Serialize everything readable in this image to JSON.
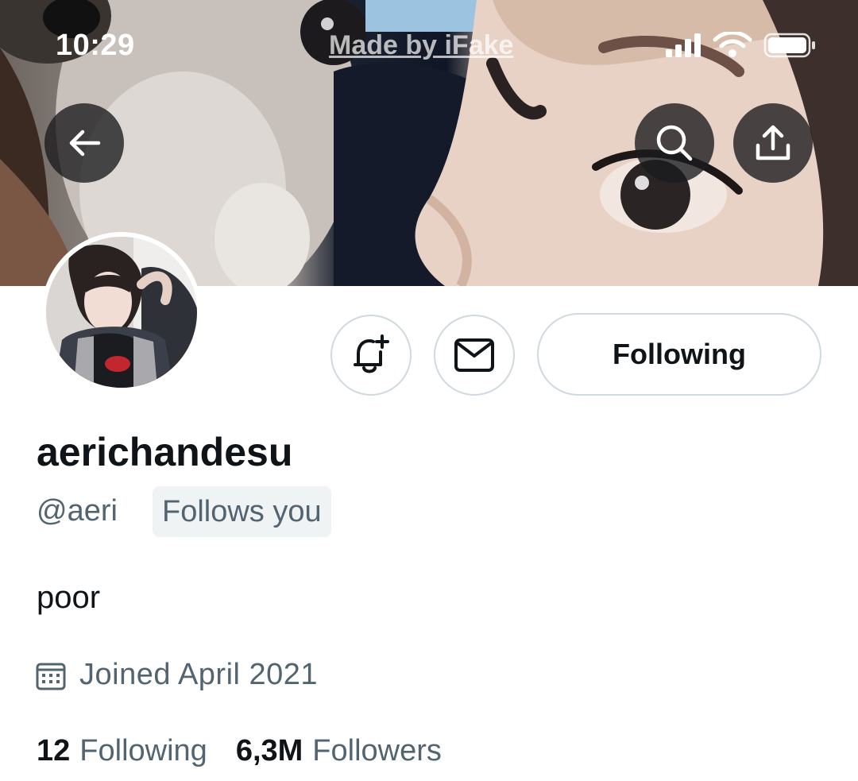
{
  "status_bar": {
    "time": "10:29",
    "watermark": "Made by iFake"
  },
  "header": {
    "back_icon": "arrow-left-icon",
    "search_icon": "search-icon",
    "share_icon": "share-upload-icon"
  },
  "actions": {
    "notify_icon": "bell-plus-icon",
    "message_icon": "envelope-icon",
    "following_label": "Following"
  },
  "profile": {
    "display_name": "aerichandesu",
    "handle": "@aeri",
    "follows_you": "Follows you",
    "bio": "poor",
    "joined": "Joined April 2021",
    "following_count": "12",
    "following_label": "Following",
    "followers_count": "6,3M",
    "followers_label": "Followers"
  },
  "colors": {
    "text_primary": "#0f1419",
    "text_secondary": "#536471",
    "border": "#cfd9de",
    "badge_bg": "#eff3f4"
  }
}
